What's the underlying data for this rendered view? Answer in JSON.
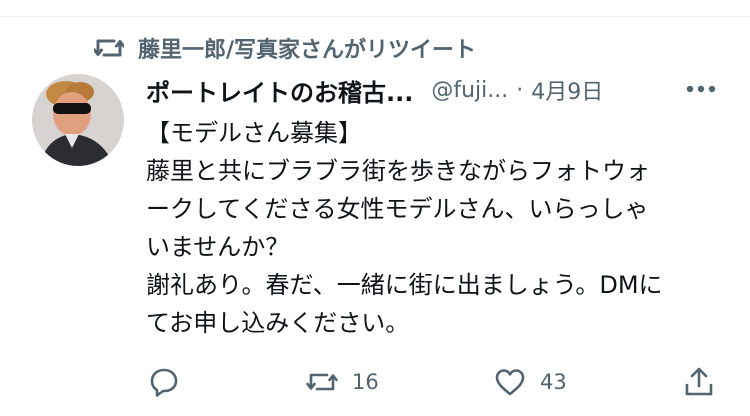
{
  "retweet_context": {
    "icon": "retweet-icon",
    "text": "藤里一郎/写真家さんがリツイート"
  },
  "tweet": {
    "author_name": "ポートレイトのお稽古...",
    "handle": "@fuji...",
    "separator": "·",
    "date": "4月9日",
    "more_icon": "more-horizontal-icon",
    "text_lines": [
      "【モデルさん募集】",
      "藤里と共にブラブラ街を歩きながらフォトウォ",
      "ークしてくださる女性モデルさん、いらっしゃ",
      "いませんか？",
      "謝礼あり。春だ、一緒に街に出ましょう。DMに",
      "てお申し込みください。"
    ]
  },
  "actions": {
    "reply": {
      "icon": "reply-icon"
    },
    "retweet": {
      "icon": "retweet-icon",
      "count": "16"
    },
    "like": {
      "icon": "heart-icon",
      "count": "43"
    },
    "share": {
      "icon": "share-icon"
    }
  },
  "colors": {
    "primary_text": "#0f1419",
    "secondary_text": "#536471",
    "divider": "#eff3f4"
  }
}
